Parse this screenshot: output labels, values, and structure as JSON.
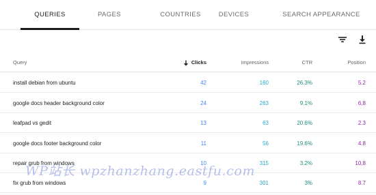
{
  "tabs": [
    {
      "label": "QUERIES",
      "active": true
    },
    {
      "label": "PAGES",
      "active": false
    },
    {
      "label": "COUNTRIES",
      "active": false
    },
    {
      "label": "DEVICES",
      "active": false
    },
    {
      "label": "SEARCH APPEARANCE",
      "active": false
    }
  ],
  "toolbar": {
    "filter_icon": "filter-icon",
    "download_icon": "download-icon"
  },
  "table": {
    "headers": {
      "query": "Query",
      "clicks": "Clicks",
      "impressions": "Impressions",
      "ctr": "CTR",
      "position": "Position"
    },
    "sort_icon": "arrow-down-icon",
    "rows": [
      {
        "query": "install debian from ubuntu",
        "clicks": "42",
        "impressions": "160",
        "ctr": "26.3%",
        "position": "5.2"
      },
      {
        "query": "google docs header background color",
        "clicks": "24",
        "impressions": "263",
        "ctr": "9.1%",
        "position": "6.8"
      },
      {
        "query": "leafpad vs gedit",
        "clicks": "13",
        "impressions": "63",
        "ctr": "20.6%",
        "position": "2.3"
      },
      {
        "query": "google docs footer background color",
        "clicks": "11",
        "impressions": "56",
        "ctr": "19.6%",
        "position": "4.8"
      },
      {
        "query": "repair grub from windows",
        "clicks": "10",
        "impressions": "315",
        "ctr": "3.2%",
        "position": "10.8"
      },
      {
        "query": "fix grub from windows",
        "clicks": "9",
        "impressions": "301",
        "ctr": "3%",
        "position": "8.7"
      }
    ]
  },
  "colors": {
    "clicks": "#4285f4",
    "impressions": "#26a8c8",
    "ctr": "#1e8c7e",
    "position": "#8e24aa"
  },
  "watermark": "WP站长  wpzhanzhang.eastfu.com"
}
